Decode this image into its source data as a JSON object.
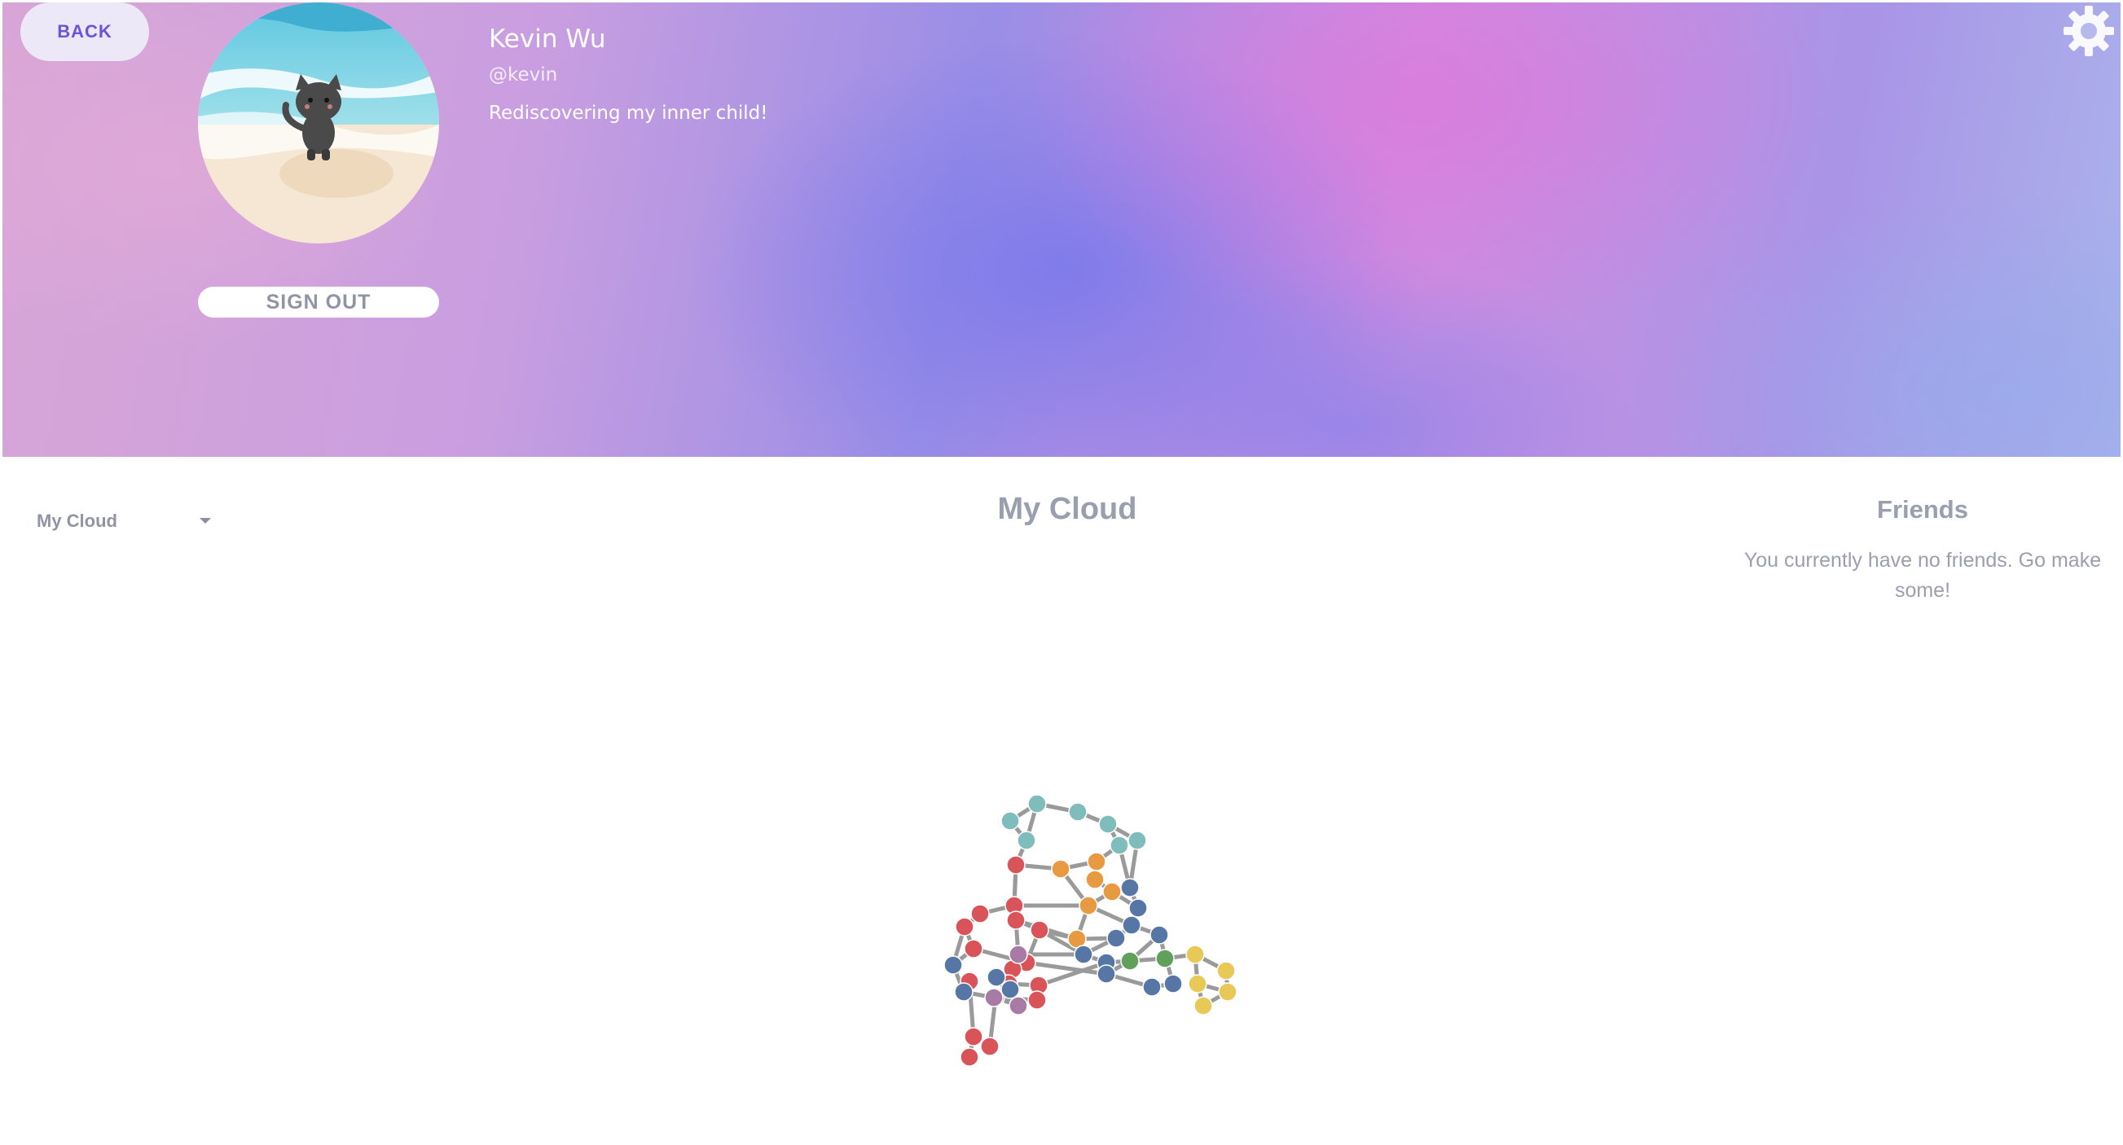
{
  "header": {
    "back_label": "BACK",
    "signout_label": "SIGN OUT",
    "settings_icon": "gear-icon",
    "avatar_icon": "cat-on-beach-avatar"
  },
  "profile": {
    "name": "Kevin Wu",
    "handle": "@kevin",
    "bio": "Rediscovering my inner child!"
  },
  "cloud_select": {
    "selected": "My Cloud"
  },
  "cloud": {
    "title": "My Cloud",
    "colors": {
      "teal": "#7fbcbc",
      "orange": "#e89a42",
      "red": "#d95459",
      "blue": "#5677a6",
      "purple": "#a97aa3",
      "green": "#61a05a",
      "yellow": "#e8c957",
      "edge": "#9a9a9a"
    }
  },
  "friends": {
    "title": "Friends",
    "empty_message": "You currently have no friends. Go make some!"
  }
}
